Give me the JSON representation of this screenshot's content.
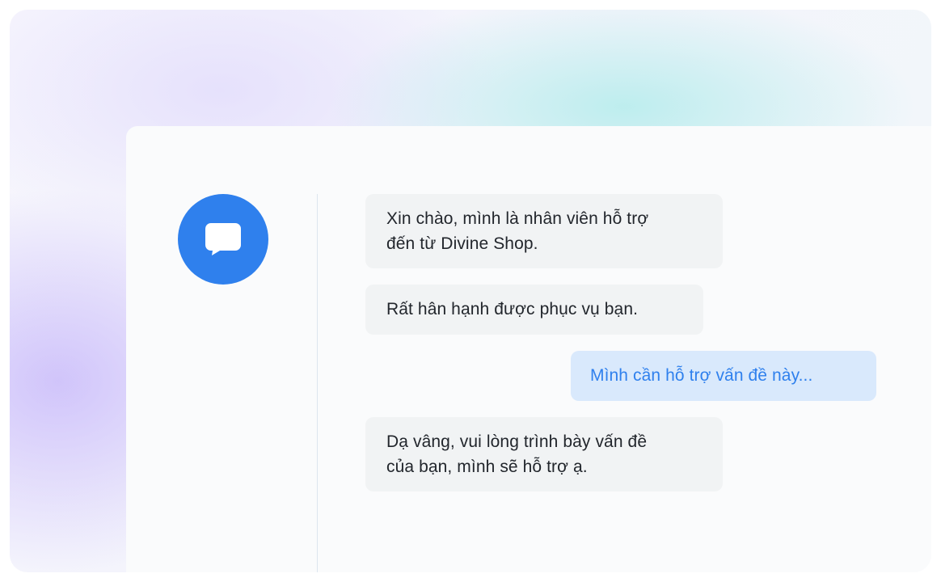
{
  "chat": {
    "avatar_icon": "chat-bubble-icon",
    "colors": {
      "accent": "#2f80ed",
      "agent_bubble": "#f1f3f4",
      "user_bubble": "#d9e9fc",
      "card_background": "#fafbfc"
    },
    "messages": [
      {
        "sender": "agent",
        "lines": [
          "Xin chào, mình là nhân viên hỗ trợ",
          "đến từ Divine Shop."
        ]
      },
      {
        "sender": "agent",
        "lines": [
          "Rất hân hạnh được phục vụ bạn."
        ]
      },
      {
        "sender": "user",
        "lines": [
          "Mình cần hỗ trợ vấn đề này..."
        ]
      },
      {
        "sender": "agent",
        "lines": [
          "Dạ vâng, vui lòng trình bày vấn đề",
          "của bạn, mình sẽ hỗ trợ ạ."
        ]
      }
    ]
  }
}
